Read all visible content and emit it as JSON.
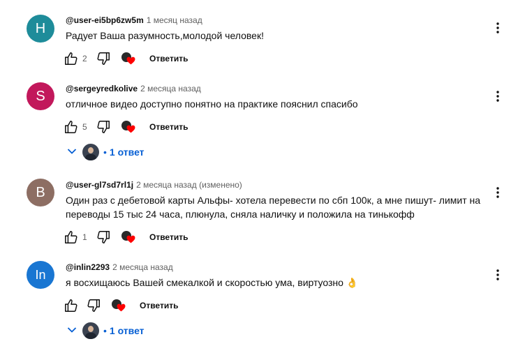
{
  "comments": [
    {
      "avatar_letter": "H",
      "avatar_color": "#1e8c9a",
      "author": "@user-ei5bp6zw5m",
      "time": "1 месяц назад",
      "text": "Радует Ваша разумность,молодой человек!",
      "likes": "2",
      "reply_label": "Ответить",
      "has_replies": false
    },
    {
      "avatar_letter": "S",
      "avatar_color": "#c2185b",
      "author": "@sergeyredkolive",
      "time": "2 месяца назад",
      "text": "отличное видео доступно понятно на практике пояснил спасибо",
      "likes": "5",
      "reply_label": "Ответить",
      "has_replies": true,
      "replies_label": "1 ответ"
    },
    {
      "avatar_letter": "B",
      "avatar_color": "#8d6e63",
      "author": "@user-gl7sd7rl1j",
      "time": "2 месяца назад (изменено)",
      "text": "Один раз с дебетовой карты Альфы- хотела перевести по сбп 100к, а мне пишут- лимит на переводы 15 тыс 24 часа, плюнула, сняла наличку и положила на тинькофф",
      "likes": "1",
      "reply_label": "Ответить",
      "has_replies": false
    },
    {
      "avatar_letter": "In",
      "avatar_color": "#1976d2",
      "author": "@inlin2293",
      "time": "2 месяца назад",
      "text": "я восхищаюсь Вашей смекалкой и скоростью ума, виртуозно 👌",
      "likes": "",
      "reply_label": "Ответить",
      "has_replies": true,
      "replies_label": "1 ответ"
    }
  ],
  "icons": {
    "like": "thumb-up-icon",
    "dislike": "thumb-down-icon",
    "heart": "creator-heart-icon",
    "menu": "more-vert-icon",
    "expand": "chevron-down-icon"
  },
  "colors": {
    "link_blue": "#065fd4",
    "heart_red": "#ff0000",
    "muted": "#606060"
  }
}
